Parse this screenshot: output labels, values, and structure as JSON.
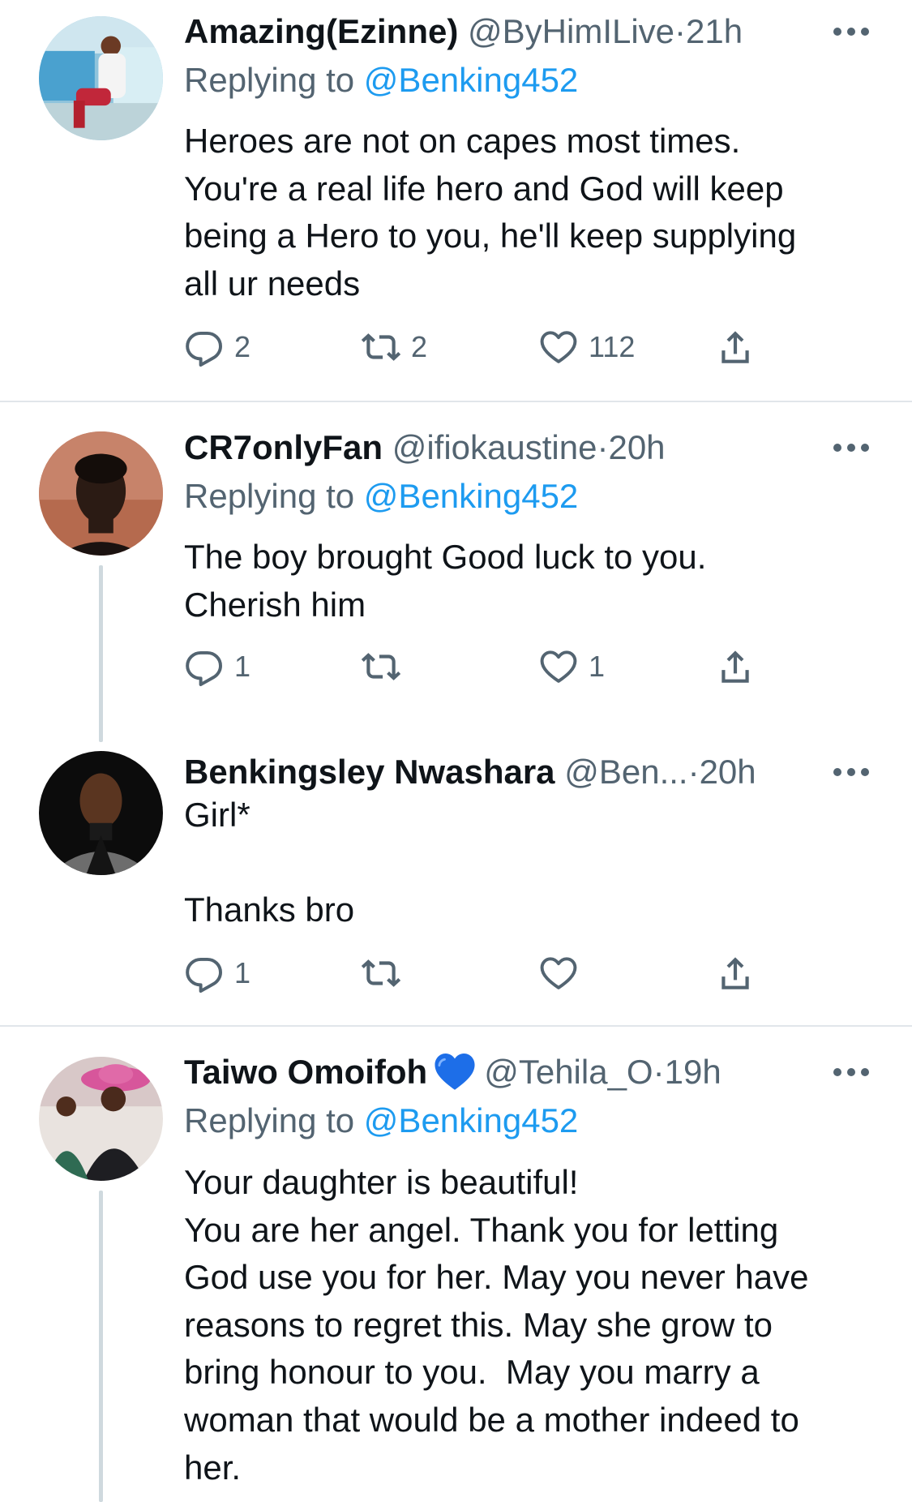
{
  "tweets": [
    {
      "name": "Amazing(Ezinne)",
      "handle": "@ByHimILive",
      "separator": "·",
      "time": "21h",
      "replying_prefix": "Replying to ",
      "replying_handle": "@Benking452",
      "text": "Heroes are not on capes most times.\nYou're a real life hero and God will keep\nbeing a Hero to you, he'll keep supplying\nall ur needs",
      "reply_count": "2",
      "retweet_count": "2",
      "like_count": "112"
    },
    {
      "name": "CR7onlyFan",
      "handle": "@ifiokaustine",
      "separator": "·",
      "time": "20h",
      "replying_prefix": "Replying to ",
      "replying_handle": "@Benking452",
      "text": "The boy brought Good luck to you.\nCherish him",
      "reply_count": "1",
      "retweet_count": "",
      "like_count": "1"
    },
    {
      "name": "Benkingsley Nwashara",
      "handle": "@Ben...",
      "separator": "·",
      "time": "20h",
      "text": "Girl*\n\nThanks bro",
      "reply_count": "1",
      "retweet_count": "",
      "like_count": ""
    },
    {
      "name": "Taiwo Omoifoh",
      "handle": "@Tehila_O",
      "separator": "·",
      "time": "19h",
      "replying_prefix": "Replying to ",
      "replying_handle": "@Benking452",
      "text": "Your daughter is beautiful!\nYou are her angel. Thank you for letting\nGod use you for her. May you never have\nreasons to regret this. May she grow to\nbring honour to you.  May you marry a\nwoman that would be a mother indeed to\nher.",
      "reply_count": "",
      "retweet_count": "",
      "like_count": ""
    }
  ],
  "colors": {
    "link": "#1d9bf0",
    "secondary_text": "#536471",
    "primary_text": "#0f1419",
    "thread_line": "#cfd9de",
    "divider": "#e1e6ea",
    "verified_heart": "#1d6ee8"
  },
  "icons": {
    "reply": "reply-icon",
    "retweet": "retweet-icon",
    "like": "heart-icon",
    "share": "share-icon",
    "more": "more-options-icon"
  }
}
